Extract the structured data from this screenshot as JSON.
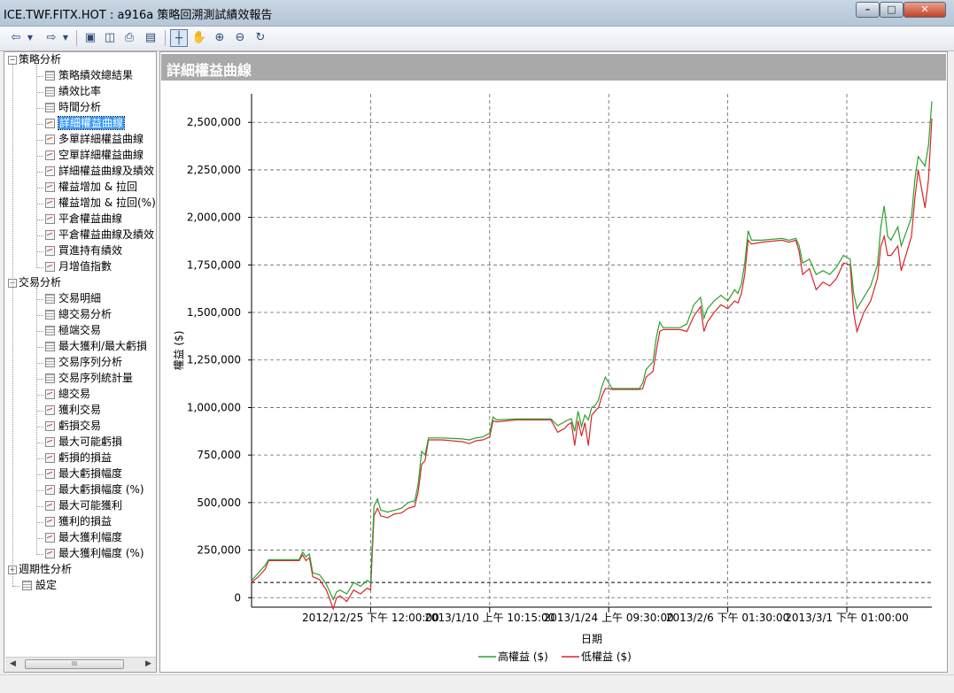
{
  "window": {
    "title": "ICE.TWF.FITX.HOT : a916a 策略回溯測試績效報告",
    "min_glyph": "–",
    "max_glyph": "□",
    "close_glyph": "✕"
  },
  "toolbar": {
    "icons": [
      "back-arrow-icon",
      "forward-arrow-icon",
      "save-icon",
      "print-preview-icon",
      "print-icon",
      "export-icon",
      "pointer-icon",
      "hand-pan-icon",
      "zoom-in-icon",
      "zoom-out-icon",
      "reset-zoom-icon"
    ]
  },
  "tree": {
    "groups": [
      {
        "label": "策略分析",
        "expander": "−",
        "items": [
          {
            "label": "策略績效總結果",
            "icon": "grid"
          },
          {
            "label": "績效比率",
            "icon": "grid"
          },
          {
            "label": "時間分析",
            "icon": "grid"
          },
          {
            "label": "詳細權益曲線",
            "icon": "chart",
            "selected": true
          },
          {
            "label": "多單詳細權益曲線",
            "icon": "chart"
          },
          {
            "label": "空單詳細權益曲線",
            "icon": "chart"
          },
          {
            "label": "詳細權益曲線及績效",
            "icon": "chart"
          },
          {
            "label": "權益增加 & 拉回",
            "icon": "chart"
          },
          {
            "label": "權益增加 & 拉回(%)",
            "icon": "chart"
          },
          {
            "label": "平倉權益曲線",
            "icon": "chart"
          },
          {
            "label": "平倉權益曲線及績效",
            "icon": "chart"
          },
          {
            "label": "買進持有績效",
            "icon": "chart"
          },
          {
            "label": "月增值指數",
            "icon": "chart"
          }
        ]
      },
      {
        "label": "交易分析",
        "expander": "−",
        "items": [
          {
            "label": "交易明細",
            "icon": "grid"
          },
          {
            "label": "總交易分析",
            "icon": "grid"
          },
          {
            "label": "極端交易",
            "icon": "grid"
          },
          {
            "label": "最大獲利/最大虧損",
            "icon": "grid"
          },
          {
            "label": "交易序列分析",
            "icon": "grid"
          },
          {
            "label": "交易序列統計量",
            "icon": "grid"
          },
          {
            "label": "總交易",
            "icon": "chart"
          },
          {
            "label": "獲利交易",
            "icon": "chart"
          },
          {
            "label": "虧損交易",
            "icon": "chart"
          },
          {
            "label": "最大可能虧損",
            "icon": "chart"
          },
          {
            "label": "虧損的損益",
            "icon": "chart"
          },
          {
            "label": "最大虧損幅度",
            "icon": "chart"
          },
          {
            "label": "最大虧損幅度 (%)",
            "icon": "chart"
          },
          {
            "label": "最大可能獲利",
            "icon": "chart"
          },
          {
            "label": "獲利的損益",
            "icon": "chart"
          },
          {
            "label": "最大獲利幅度",
            "icon": "chart"
          },
          {
            "label": "最大獲利幅度 (%)",
            "icon": "chart"
          }
        ]
      },
      {
        "label": "週期性分析",
        "expander": "+",
        "items": []
      }
    ],
    "extra": {
      "label": "設定",
      "icon": "grid"
    },
    "scroll_thumb": "III"
  },
  "chart_header": "詳細權益曲線",
  "chart_data": {
    "type": "line",
    "xlabel": "日期",
    "ylabel": "權益 ($)",
    "ylim": [
      -50000,
      2650000
    ],
    "yticks": [
      0,
      250000,
      500000,
      750000,
      1000000,
      1250000,
      1500000,
      1750000,
      2000000,
      2250000,
      2500000
    ],
    "ytick_labels": [
      "0",
      "250,000",
      "500,000",
      "750,000",
      "1,000,000",
      "1,250,000",
      "1,500,000",
      "1,750,000",
      "2,000,000",
      "2,250,000",
      "2,500,000"
    ],
    "xlim": [
      0,
      100
    ],
    "xticks": [
      17.5,
      35,
      52.5,
      70,
      87.5
    ],
    "xtick_labels": [
      "2012/12/25 下午 12:00:00",
      "2013/1/10 上午 10:15:00",
      "2013/1/24 上午 09:30:00",
      "2013/2/6 下午 01:30:00",
      "2013/3/1 下午 01:00:00"
    ],
    "reference_line": 80000,
    "grid": true,
    "legend_position": "bottom",
    "series": [
      {
        "name": "高權益 ($)",
        "color": "#2ca02c",
        "points": [
          [
            0,
            90000
          ],
          [
            1,
            130000
          ],
          [
            2,
            170000
          ],
          [
            2.5,
            200000
          ],
          [
            4,
            200000
          ],
          [
            7,
            200000
          ],
          [
            7.5,
            240000
          ],
          [
            8,
            215000
          ],
          [
            8.5,
            230000
          ],
          [
            9,
            130000
          ],
          [
            10,
            120000
          ],
          [
            11,
            70000
          ],
          [
            12,
            -10000
          ],
          [
            12.5,
            30000
          ],
          [
            13,
            40000
          ],
          [
            14,
            20000
          ],
          [
            15,
            80000
          ],
          [
            16,
            60000
          ],
          [
            17,
            90000
          ],
          [
            17.5,
            80000
          ],
          [
            18,
            480000
          ],
          [
            18.5,
            520000
          ],
          [
            19,
            460000
          ],
          [
            20,
            450000
          ],
          [
            21,
            460000
          ],
          [
            22,
            470000
          ],
          [
            23,
            500000
          ],
          [
            24,
            510000
          ],
          [
            24.5,
            600000
          ],
          [
            25,
            770000
          ],
          [
            25.5,
            750000
          ],
          [
            26,
            840000
          ],
          [
            28,
            840000
          ],
          [
            31,
            835000
          ],
          [
            32,
            830000
          ],
          [
            33,
            840000
          ],
          [
            34,
            845000
          ],
          [
            35,
            865000
          ],
          [
            35.5,
            950000
          ],
          [
            36,
            935000
          ],
          [
            39,
            940000
          ],
          [
            44,
            940000
          ],
          [
            45,
            905000
          ],
          [
            46,
            925000
          ],
          [
            46.5,
            935000
          ],
          [
            47,
            940000
          ],
          [
            47.5,
            875000
          ],
          [
            48,
            980000
          ],
          [
            48.5,
            900000
          ],
          [
            49,
            960000
          ],
          [
            49.5,
            935000
          ],
          [
            50,
            1000000
          ],
          [
            50.5,
            1010000
          ],
          [
            51,
            1040000
          ],
          [
            51.5,
            1110000
          ],
          [
            52,
            1160000
          ],
          [
            52.5,
            1130000
          ],
          [
            53,
            1100000
          ],
          [
            57,
            1100000
          ],
          [
            57.5,
            1130000
          ],
          [
            58,
            1200000
          ],
          [
            59,
            1240000
          ],
          [
            59.5,
            1370000
          ],
          [
            60,
            1450000
          ],
          [
            60.5,
            1420000
          ],
          [
            63,
            1420000
          ],
          [
            64,
            1440000
          ],
          [
            65,
            1540000
          ],
          [
            66,
            1580000
          ],
          [
            66.5,
            1470000
          ],
          [
            67,
            1520000
          ],
          [
            68,
            1560000
          ],
          [
            69,
            1590000
          ],
          [
            70,
            1560000
          ],
          [
            71,
            1620000
          ],
          [
            71.5,
            1600000
          ],
          [
            72,
            1650000
          ],
          [
            72.5,
            1760000
          ],
          [
            73,
            1930000
          ],
          [
            73.5,
            1880000
          ],
          [
            75,
            1880000
          ],
          [
            78,
            1890000
          ],
          [
            79,
            1880000
          ],
          [
            80,
            1890000
          ],
          [
            80.5,
            1850000
          ],
          [
            81,
            1760000
          ],
          [
            82,
            1780000
          ],
          [
            83,
            1700000
          ],
          [
            84,
            1720000
          ],
          [
            85,
            1700000
          ],
          [
            86,
            1740000
          ],
          [
            87,
            1800000
          ],
          [
            88,
            1780000
          ],
          [
            88.5,
            1600000
          ],
          [
            89,
            1520000
          ],
          [
            90,
            1580000
          ],
          [
            91,
            1640000
          ],
          [
            92,
            1750000
          ],
          [
            92.5,
            1950000
          ],
          [
            93,
            2060000
          ],
          [
            93.5,
            1900000
          ],
          [
            94,
            1880000
          ],
          [
            95,
            1950000
          ],
          [
            95.5,
            1850000
          ],
          [
            96,
            1900000
          ],
          [
            97,
            2000000
          ],
          [
            97.5,
            2200000
          ],
          [
            98,
            2320000
          ],
          [
            99,
            2270000
          ],
          [
            99.5,
            2380000
          ],
          [
            100,
            2610000
          ]
        ]
      },
      {
        "name": "低權益 ($)",
        "color": "#d62728",
        "points": [
          [
            0,
            80000
          ],
          [
            1,
            110000
          ],
          [
            2,
            150000
          ],
          [
            2.5,
            195000
          ],
          [
            4,
            195000
          ],
          [
            7,
            195000
          ],
          [
            7.5,
            225000
          ],
          [
            8,
            195000
          ],
          [
            8.5,
            210000
          ],
          [
            9,
            110000
          ],
          [
            10,
            95000
          ],
          [
            11,
            40000
          ],
          [
            12,
            -60000
          ],
          [
            12.5,
            0
          ],
          [
            13,
            10000
          ],
          [
            14,
            -20000
          ],
          [
            15,
            40000
          ],
          [
            16,
            20000
          ],
          [
            17,
            50000
          ],
          [
            17.5,
            40000
          ],
          [
            18,
            430000
          ],
          [
            18.5,
            470000
          ],
          [
            19,
            430000
          ],
          [
            20,
            420000
          ],
          [
            21,
            440000
          ],
          [
            22,
            445000
          ],
          [
            23,
            470000
          ],
          [
            24,
            480000
          ],
          [
            24.5,
            560000
          ],
          [
            25,
            700000
          ],
          [
            25.5,
            720000
          ],
          [
            26,
            830000
          ],
          [
            28,
            830000
          ],
          [
            31,
            820000
          ],
          [
            32,
            810000
          ],
          [
            33,
            825000
          ],
          [
            34,
            830000
          ],
          [
            35,
            845000
          ],
          [
            35.5,
            930000
          ],
          [
            36,
            925000
          ],
          [
            39,
            935000
          ],
          [
            44,
            935000
          ],
          [
            45,
            870000
          ],
          [
            46,
            890000
          ],
          [
            46.5,
            910000
          ],
          [
            47,
            920000
          ],
          [
            47.5,
            800000
          ],
          [
            48,
            930000
          ],
          [
            48.5,
            850000
          ],
          [
            49,
            920000
          ],
          [
            49.5,
            800000
          ],
          [
            50,
            960000
          ],
          [
            50.5,
            980000
          ],
          [
            51,
            1000000
          ],
          [
            51.5,
            1060000
          ],
          [
            52,
            1100000
          ],
          [
            52.5,
            1100000
          ],
          [
            53,
            1095000
          ],
          [
            57,
            1095000
          ],
          [
            57.5,
            1100000
          ],
          [
            58,
            1160000
          ],
          [
            59,
            1190000
          ],
          [
            59.5,
            1300000
          ],
          [
            60,
            1400000
          ],
          [
            60.5,
            1410000
          ],
          [
            63,
            1410000
          ],
          [
            64,
            1400000
          ],
          [
            65,
            1480000
          ],
          [
            66,
            1530000
          ],
          [
            66.5,
            1400000
          ],
          [
            67,
            1450000
          ],
          [
            68,
            1500000
          ],
          [
            69,
            1540000
          ],
          [
            70,
            1520000
          ],
          [
            71,
            1560000
          ],
          [
            71.5,
            1550000
          ],
          [
            72,
            1600000
          ],
          [
            72.5,
            1700000
          ],
          [
            73,
            1880000
          ],
          [
            73.5,
            1860000
          ],
          [
            75,
            1870000
          ],
          [
            78,
            1880000
          ],
          [
            79,
            1870000
          ],
          [
            80,
            1880000
          ],
          [
            80.5,
            1820000
          ],
          [
            81,
            1700000
          ],
          [
            82,
            1730000
          ],
          [
            83,
            1620000
          ],
          [
            84,
            1660000
          ],
          [
            85,
            1640000
          ],
          [
            86,
            1680000
          ],
          [
            87,
            1760000
          ],
          [
            88,
            1750000
          ],
          [
            88.5,
            1500000
          ],
          [
            89,
            1400000
          ],
          [
            90,
            1500000
          ],
          [
            91,
            1560000
          ],
          [
            92,
            1680000
          ],
          [
            92.5,
            1850000
          ],
          [
            93,
            1900000
          ],
          [
            93.5,
            1800000
          ],
          [
            94,
            1800000
          ],
          [
            95,
            1850000
          ],
          [
            95.5,
            1720000
          ],
          [
            96,
            1780000
          ],
          [
            97,
            1900000
          ],
          [
            97.5,
            2100000
          ],
          [
            98,
            2250000
          ],
          [
            99,
            2050000
          ],
          [
            99.5,
            2200000
          ],
          [
            100,
            2520000
          ]
        ]
      }
    ]
  }
}
